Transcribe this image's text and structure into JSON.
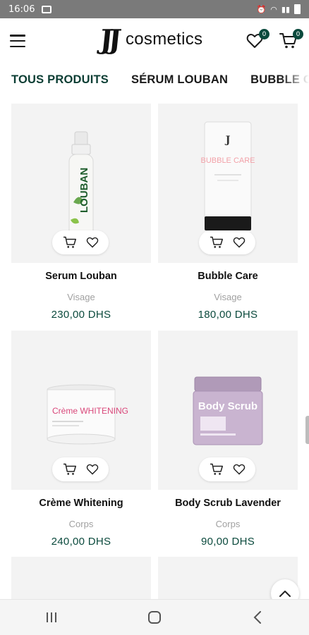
{
  "status_bar": {
    "time": "16:06"
  },
  "header": {
    "logo_mark": "JJ",
    "logo_text": "cosmetics",
    "wishlist_count": "0",
    "cart_count": "0",
    "accent_color": "#0b4a3d"
  },
  "tabs": [
    {
      "label": "TOUS PRODUITS"
    },
    {
      "label": "SÉRUM LOUBAN"
    },
    {
      "label": "BUBBLE C/"
    }
  ],
  "products": [
    {
      "name": "Serum Louban",
      "category": "Visage",
      "price": "230,00 DHS",
      "image_label": "LOUBAN"
    },
    {
      "name": "Bubble Care",
      "category": "Visage",
      "price": "180,00 DHS",
      "image_label": "BUBBLE CARE"
    },
    {
      "name": "Crème Whitening",
      "category": "Corps",
      "price": "240,00 DHS",
      "image_label": "Crème WHITENING"
    },
    {
      "name": "Body Scrub Lavender",
      "category": "Corps",
      "price": "90,00 DHS",
      "image_label": "Body Scrub"
    }
  ]
}
